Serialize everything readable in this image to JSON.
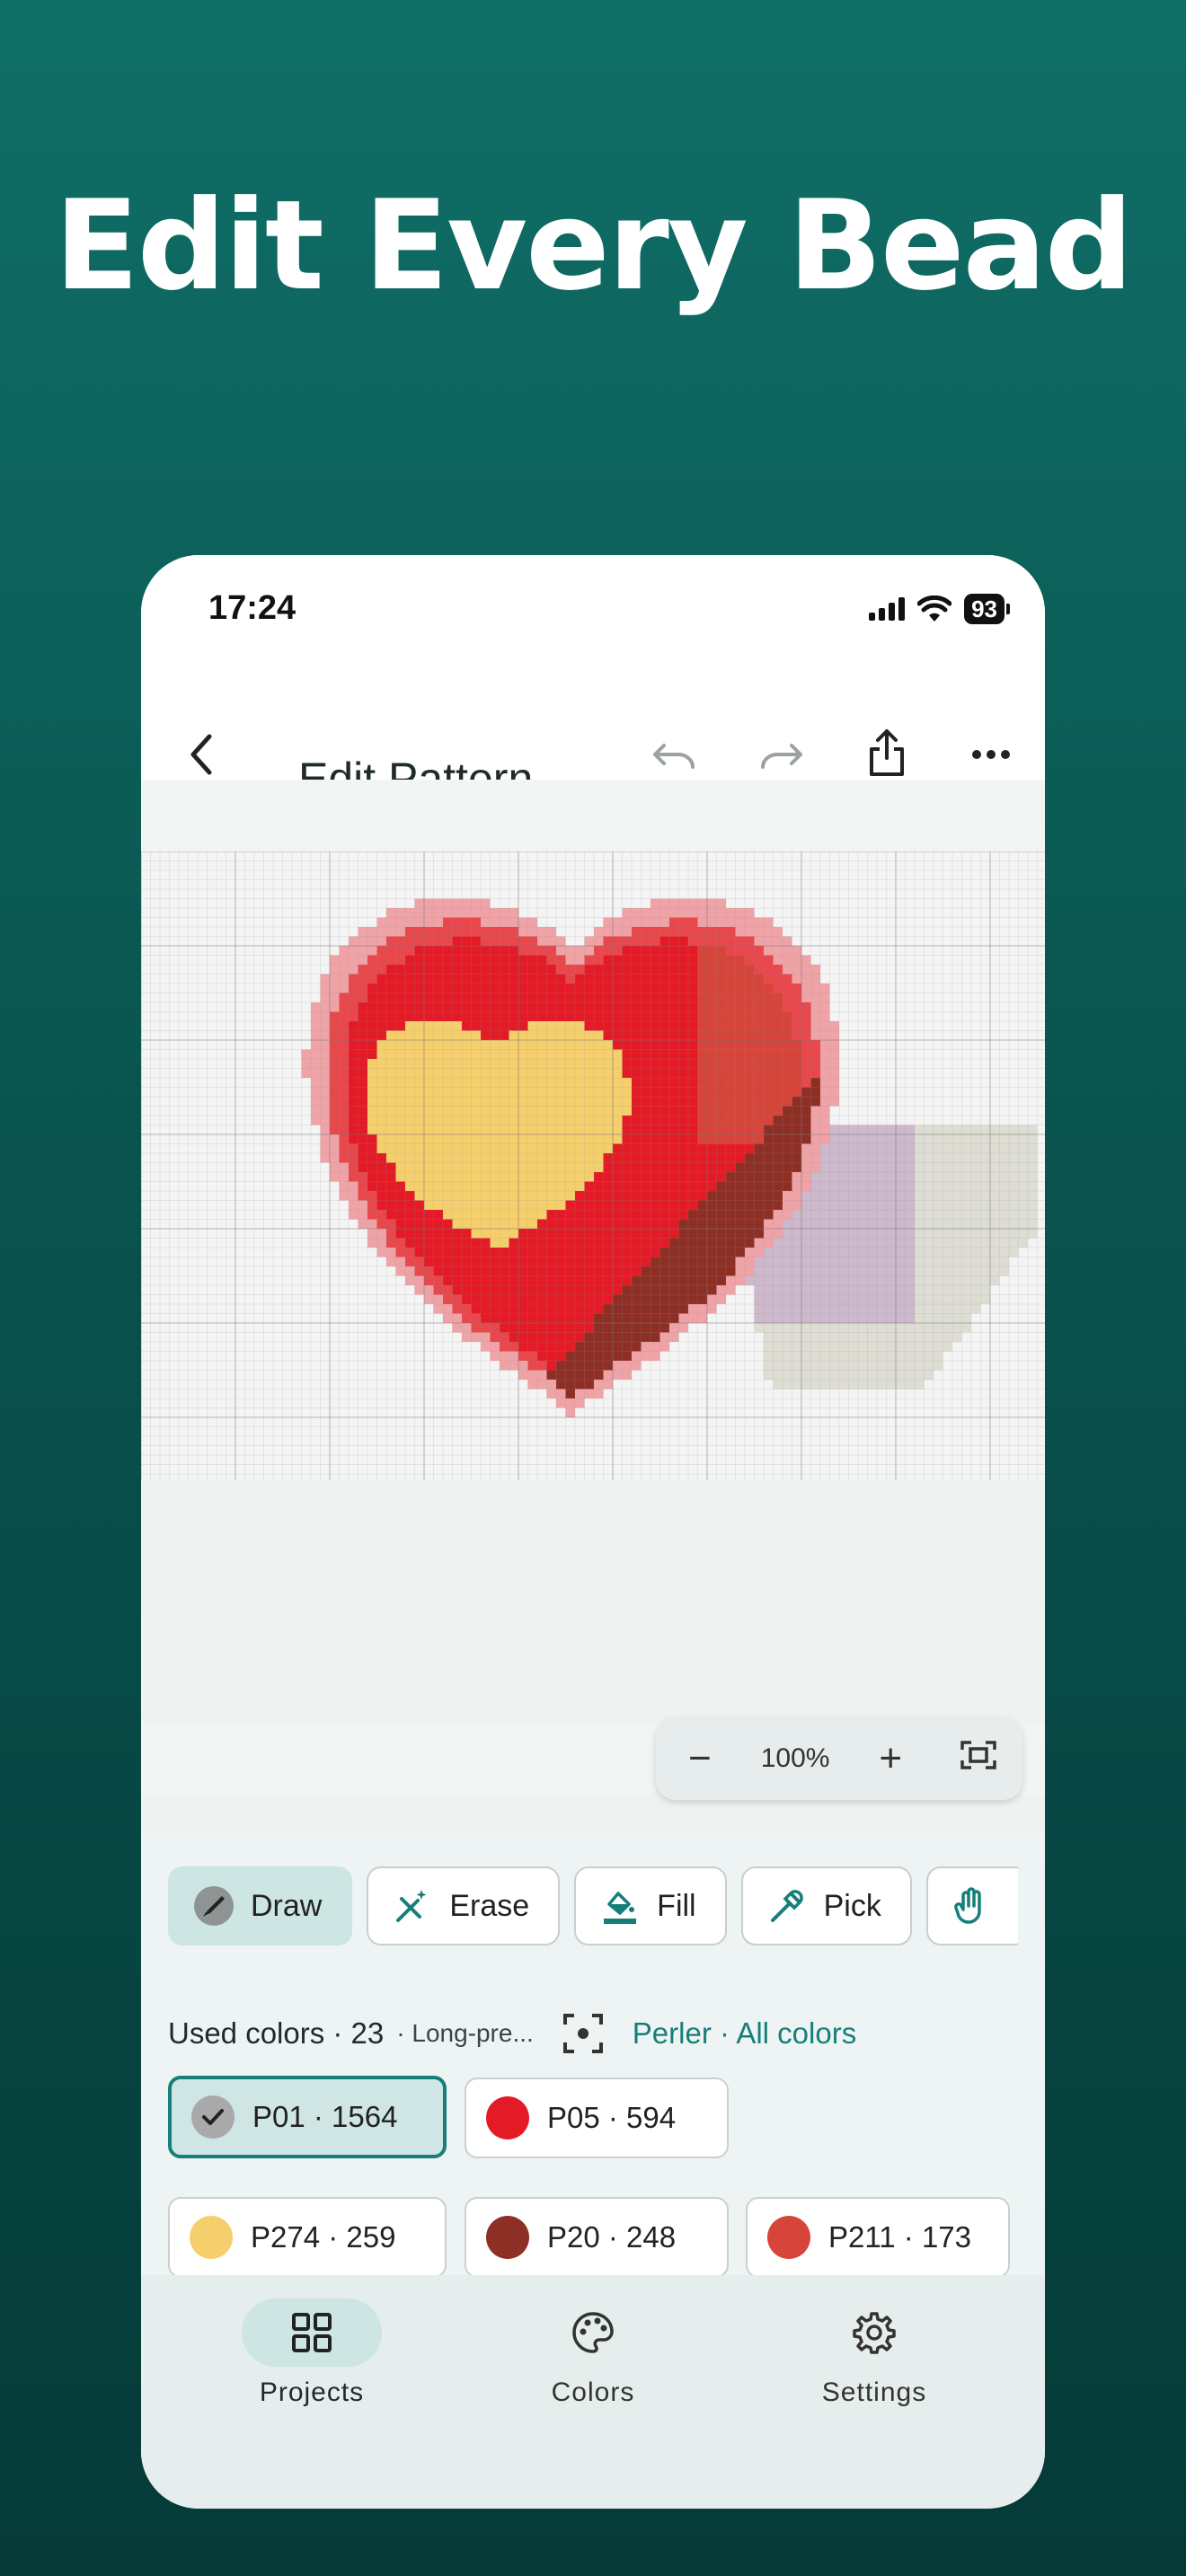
{
  "headline": "Edit Every Bead",
  "status_bar": {
    "time": "17:24",
    "battery": "93"
  },
  "toolbar": {
    "title": "Edit Pattern",
    "icons": [
      "back-icon",
      "undo-icon",
      "redo-icon",
      "share-icon",
      "more-icon"
    ]
  },
  "canvas": {
    "zoom_out_label": "−",
    "zoom_level": "100%",
    "zoom_in_label": "+",
    "fit_icon": "fit-screen-icon"
  },
  "tools": [
    {
      "label": "Draw",
      "icon": "brush-icon",
      "active": true
    },
    {
      "label": "Erase",
      "icon": "eraser-icon",
      "active": false
    },
    {
      "label": "Fill",
      "icon": "paint-bucket-icon",
      "active": false
    },
    {
      "label": "Pick",
      "icon": "eyedropper-icon",
      "active": false
    }
  ],
  "colors": {
    "used_label": "Used colors · 23",
    "mode_label": "· Long-pre...",
    "brand_label": "Perler · All colors",
    "chips": [
      {
        "label": "P01 · 1564",
        "swatch": "#a9a9a9",
        "selected": true
      },
      {
        "label": "P05 · 594",
        "swatch": "#e41b26",
        "selected": false
      },
      {
        "label": "P274 · 259",
        "swatch": "#f6cf6d",
        "selected": false
      },
      {
        "label": "P20 · 248",
        "swatch": "#8e2f25",
        "selected": false
      },
      {
        "label": "P211 · 173",
        "swatch": "#d6443a",
        "selected": false
      }
    ]
  },
  "nav": [
    {
      "label": "Projects",
      "icon": "grid-icon",
      "active": true
    },
    {
      "label": "Colors",
      "icon": "palette-icon",
      "active": false
    },
    {
      "label": "Settings",
      "icon": "gear-icon",
      "active": false
    }
  ],
  "accent_color": "#167f7a"
}
